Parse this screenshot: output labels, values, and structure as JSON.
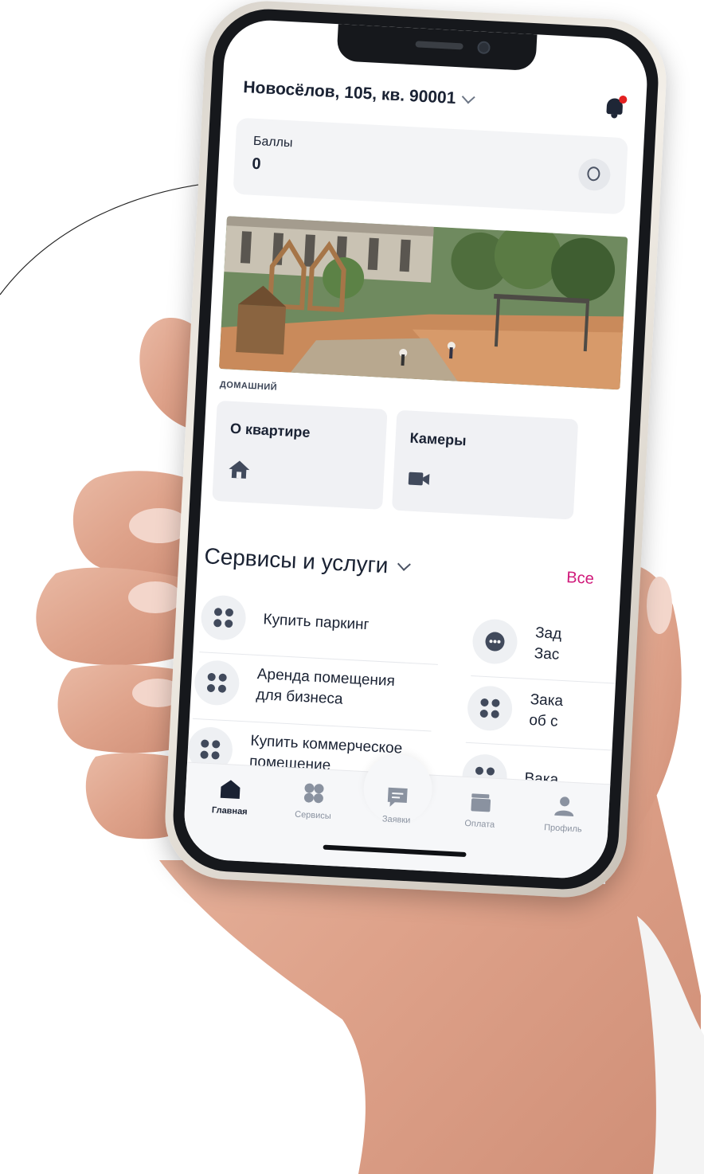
{
  "colors": {
    "accent": "#d0197a",
    "text_primary": "#1a2233",
    "notification_dot": "#e32020",
    "tile_bg": "#f0f1f4"
  },
  "header": {
    "address": "Новосёлов, 105, кв. 90001",
    "address_icon": "chevron-down-icon",
    "notification_icon": "bell-icon"
  },
  "points": {
    "label": "Баллы",
    "value": "0",
    "icon": "coin-icon"
  },
  "banner": {
    "tag": "ДОМАШНИЙ"
  },
  "tiles": [
    {
      "label": "О квартире",
      "icon": "home-icon"
    },
    {
      "label": "Камеры",
      "icon": "video-camera-icon"
    }
  ],
  "services": {
    "title": "Сервисы и услуги",
    "all_label": "Все",
    "items_left": [
      {
        "label": "Купить паркинг"
      },
      {
        "label": "Аренда помещения\nдля бизнеса"
      },
      {
        "label": "Купить коммерческое\nпомещение"
      }
    ],
    "items_right": [
      {
        "label": "Зад\nЗас"
      },
      {
        "label": "Зака\nоб с"
      },
      {
        "label": "Вака"
      }
    ]
  },
  "tabbar": {
    "tabs": [
      {
        "label": "Главная",
        "icon": "home-icon",
        "active": true
      },
      {
        "label": "Сервисы",
        "icon": "services-icon",
        "active": false
      },
      {
        "label": "Заявки",
        "icon": "requests-icon",
        "active": false
      },
      {
        "label": "Оплата",
        "icon": "wallet-icon",
        "active": false
      },
      {
        "label": "Профиль",
        "icon": "profile-icon",
        "active": false
      }
    ]
  }
}
